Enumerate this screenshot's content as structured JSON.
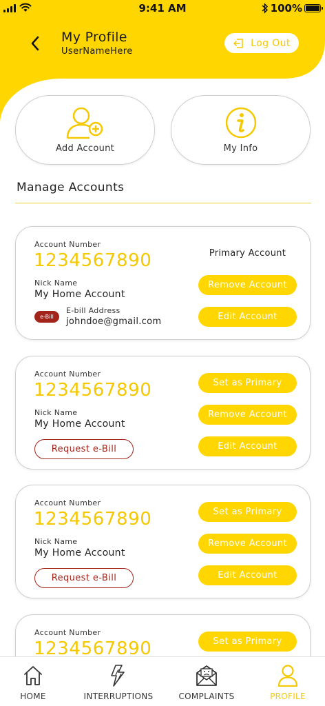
{
  "status_bar": {
    "time": "9:41 AM",
    "battery_percent": "100%",
    "battery_level": 1.0
  },
  "header": {
    "title": "My Profile",
    "subtitle": "UserNameHere",
    "logout_label": "Log Out"
  },
  "quick_actions": {
    "add_account_label": "Add Account",
    "my_info_label": "My Info"
  },
  "section_title": "Manage Accounts",
  "accounts": [
    {
      "account_number_label": "Account Number",
      "account_number": "1234567890",
      "nick_name_label": "Nick Name",
      "nick_name": "My Home Account",
      "primary_label": "Primary Account",
      "ebill_badge": "e-Bill",
      "ebill_address_label": "E-bill Address",
      "ebill_address": "johndoe@gmail.com",
      "remove_label": "Remove Account",
      "edit_label": "Edit Account"
    },
    {
      "account_number_label": "Account Number",
      "account_number": "1234567890",
      "nick_name_label": "Nick Name",
      "nick_name": "My Home Account",
      "set_primary_label": "Set as Primary",
      "remove_label": "Remove Account",
      "edit_label": "Edit Account",
      "request_ebill_label": "Request e-Bill"
    },
    {
      "account_number_label": "Account Number",
      "account_number": "1234567890",
      "nick_name_label": "Nick Name",
      "nick_name": "My Home Account",
      "set_primary_label": "Set as Primary",
      "remove_label": "Remove Account",
      "edit_label": "Edit Account",
      "request_ebill_label": "Request e-Bill"
    },
    {
      "account_number_label": "Account Number",
      "account_number": "1234567890",
      "set_primary_label": "Set as Primary"
    }
  ],
  "nav": {
    "home": "HOME",
    "interruptions": "INTERRUPTIONS",
    "complaints": "COMPLAINTS",
    "profile": "PROFILE",
    "active": "profile"
  },
  "colors": {
    "accent": "#ffd600",
    "accent_text": "#f5c800",
    "ebill_red": "#a3241a",
    "border": "#cfcfcf"
  },
  "icons": {
    "back": "chevron-left-icon",
    "logout": "logout-icon",
    "add_account": "user-plus-icon",
    "my_info": "info-icon",
    "home": "home-icon",
    "interruptions": "lightning-icon",
    "complaints": "envelope-sad-icon",
    "profile": "user-icon"
  }
}
